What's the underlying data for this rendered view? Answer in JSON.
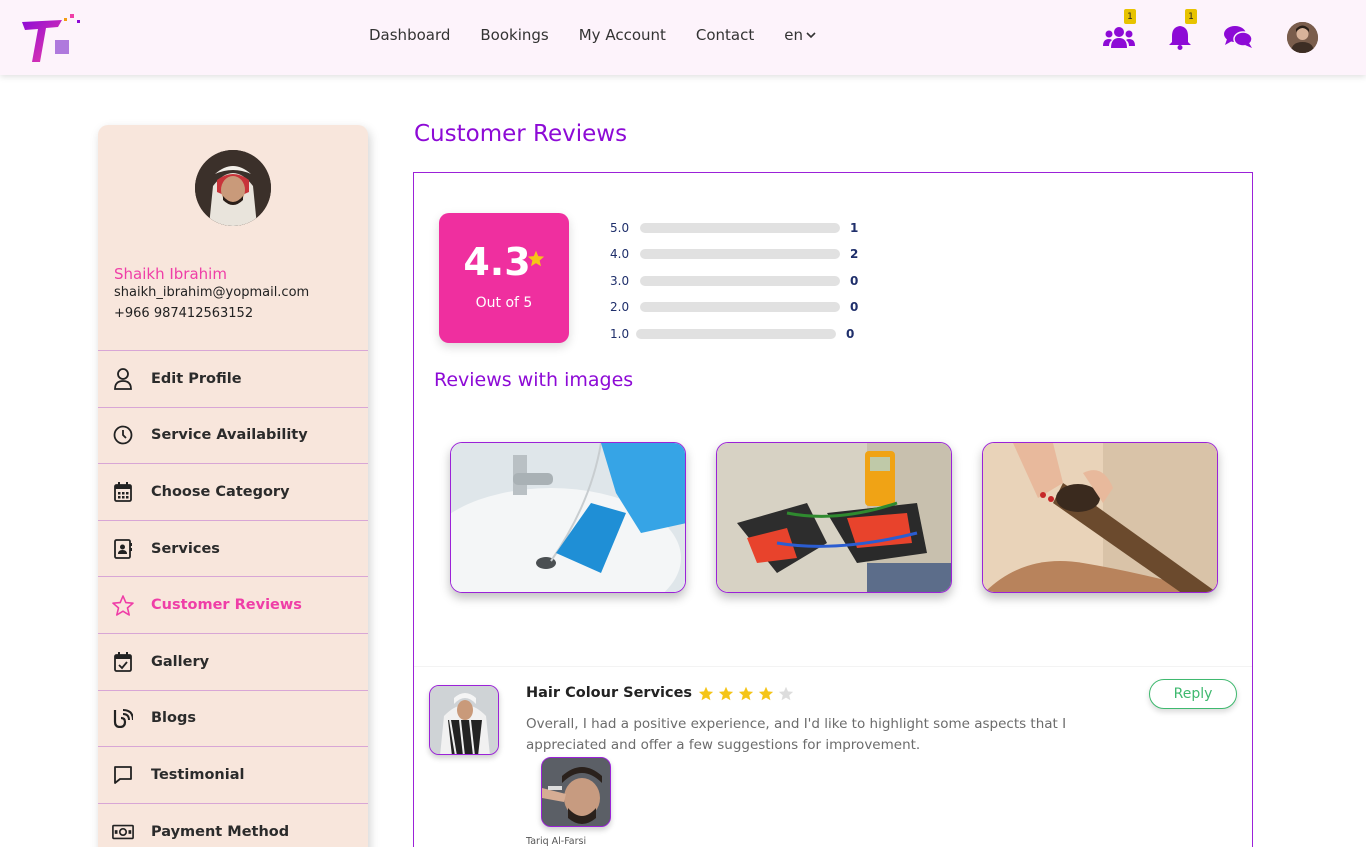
{
  "colors": {
    "accent_purple": "#8d0ad6",
    "accent_pink": "#ef3ea7",
    "rating_box": "#ef2f9f",
    "star_gold": "#f5c518",
    "reply_green": "#3fb96f",
    "sidebar_bg": "#f8e6dc"
  },
  "nav": {
    "items": [
      "Dashboard",
      "Bookings",
      "My Account",
      "Contact"
    ],
    "language": "en",
    "icons": [
      {
        "name": "users-icon",
        "badge": "1"
      },
      {
        "name": "bell-icon",
        "badge": "1"
      },
      {
        "name": "chat-icon",
        "badge": ""
      }
    ]
  },
  "profile": {
    "name": "Shaikh Ibrahim",
    "email": "shaikh_ibrahim@yopmail.com",
    "phone": "+966 987412563152"
  },
  "menu": [
    {
      "label": "Edit Profile",
      "icon": "user-icon",
      "active": false
    },
    {
      "label": "Service Availability",
      "icon": "clock-icon",
      "active": false
    },
    {
      "label": "Choose Category",
      "icon": "calendar-icon",
      "active": false
    },
    {
      "label": "Services",
      "icon": "contact-book-icon",
      "active": false
    },
    {
      "label": "Customer Reviews",
      "icon": "star-icon",
      "active": true
    },
    {
      "label": "Gallery",
      "icon": "calendar-check-icon",
      "active": false
    },
    {
      "label": "Blogs",
      "icon": "blog-icon",
      "active": false
    },
    {
      "label": "Testimonial",
      "icon": "message-icon",
      "active": false
    },
    {
      "label": "Payment Method",
      "icon": "money-icon",
      "active": false
    }
  ],
  "page_title": "Customer Reviews",
  "rating": {
    "value": "4.3",
    "out_of": "Out of 5",
    "distribution": [
      {
        "label": "5.0",
        "count": "1"
      },
      {
        "label": "4.0",
        "count": "2"
      },
      {
        "label": "3.0",
        "count": "0"
      },
      {
        "label": "2.0",
        "count": "0"
      },
      {
        "label": "1.0",
        "count": "0"
      }
    ]
  },
  "reviews_with_images_title": "Reviews with images",
  "review_images": [
    "plumbing-photo",
    "electrical-photo",
    "hair-curling-photo"
  ],
  "review": {
    "service": "Hair Colour Services",
    "stars": 4,
    "max_stars": 5,
    "text": "Overall, I had a positive experience, and I'd like to highlight some aspects that I appreciated and offer a few suggestions for improvement.",
    "reply_label": "Reply",
    "user": "Tariq Al-Farsi"
  }
}
